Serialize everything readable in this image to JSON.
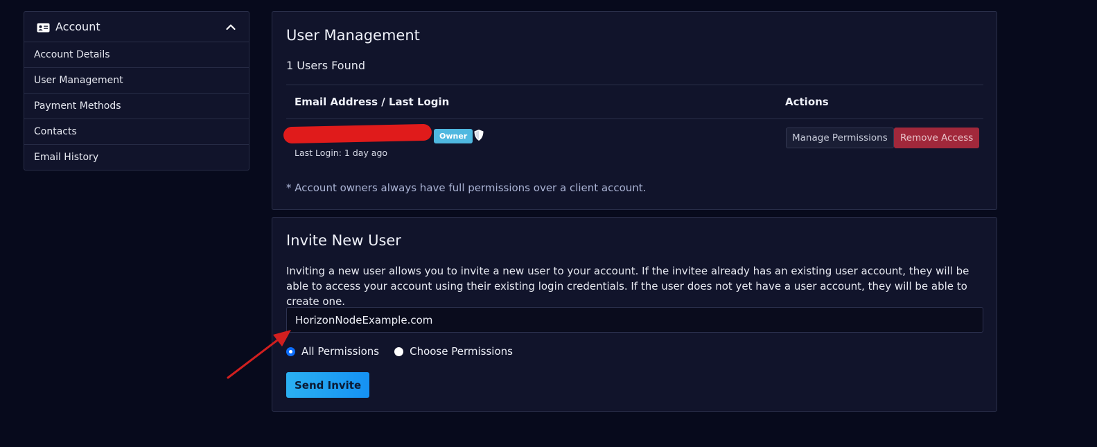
{
  "sidebar": {
    "title": "Account",
    "items": [
      {
        "label": "Account Details"
      },
      {
        "label": "User Management"
      },
      {
        "label": "Payment Methods"
      },
      {
        "label": "Contacts"
      },
      {
        "label": "Email History"
      }
    ],
    "header_icon": "id-card-icon",
    "collapse_icon": "chevron-up-icon"
  },
  "user_management": {
    "title": "User Management",
    "users_found": "1 Users Found",
    "table": {
      "headers": [
        "Email Address / Last Login",
        "Actions"
      ],
      "rows": [
        {
          "email": "",
          "badge": "Owner",
          "last_login": "Last Login: 1 day ago",
          "manage_label": "Manage Permissions",
          "remove_label": "Remove Access"
        }
      ]
    },
    "note": "* Account owners always have full permissions over a client account."
  },
  "invite": {
    "title": "Invite New User",
    "description": "Inviting a new user allows you to invite a new user to your account. If the invitee already has an existing user account, they will be able to access your account using their existing login credentials. If the user does not yet have a user account, they will be able to create one.",
    "input_value": "HorizonNodeExample.com",
    "radio_options": [
      {
        "label": "All Permissions",
        "checked": true
      },
      {
        "label": "Choose Permissions",
        "checked": false
      }
    ],
    "send_label": "Send Invite"
  },
  "colors": {
    "background": "#070a1c",
    "panel": "#11142b",
    "owner_badge": "#4fb8e0",
    "remove_button": "#a1283b",
    "send_button": "#1b9ef3",
    "annotation_arrow": "#d11f1f"
  }
}
